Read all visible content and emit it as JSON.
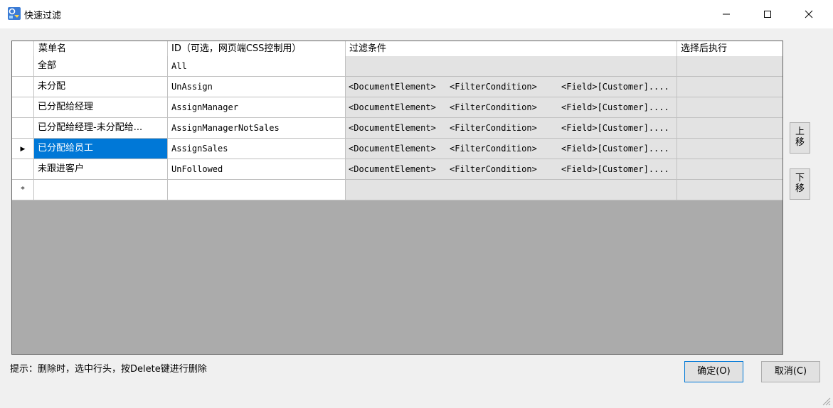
{
  "window": {
    "title": "快速过滤",
    "icons": {
      "app": "app-filter-icon",
      "minimize": "minimize-icon",
      "maximize": "maximize-icon",
      "close": "close-icon"
    }
  },
  "grid": {
    "columns": [
      "菜单名",
      "ID（可选，网页端CSS控制用）",
      "过滤条件",
      "选择后执行"
    ],
    "rows": [
      {
        "name": "全部",
        "id": "All",
        "filter": [
          "",
          "",
          ""
        ],
        "after": ""
      },
      {
        "name": "未分配",
        "id": "UnAssign",
        "filter": [
          "<DocumentElement>",
          "<FilterCondition>",
          "<Field>[Customer]...."
        ],
        "after": ""
      },
      {
        "name": "已分配给经理",
        "id": "AssignManager",
        "filter": [
          "<DocumentElement>",
          "<FilterCondition>",
          "<Field>[Customer]...."
        ],
        "after": ""
      },
      {
        "name": "已分配给经理-未分配给...",
        "id": "AssignManagerNotSales",
        "filter": [
          "<DocumentElement>",
          "<FilterCondition>",
          "<Field>[Customer]...."
        ],
        "after": ""
      },
      {
        "name": "已分配给员工",
        "id": "AssignSales",
        "filter": [
          "<DocumentElement>",
          "<FilterCondition>",
          "<Field>[Customer]...."
        ],
        "after": ""
      },
      {
        "name": "未跟进客户",
        "id": "UnFollowed",
        "filter": [
          "<DocumentElement>",
          "<FilterCondition>",
          "<Field>[Customer]...."
        ],
        "after": ""
      }
    ],
    "current_row_marker": "▶",
    "new_row_marker": "*",
    "selected_row": 4
  },
  "side": {
    "move_up": "上移",
    "move_down": "下移"
  },
  "footer": {
    "hint": "提示：删除时，选中行头，按Delete键进行删除",
    "ok_label": "确定(O)",
    "cancel_label": "取消(C)"
  },
  "colors": {
    "selection": "#0078d7",
    "grid_bg": "#ababab",
    "readonly_cell": "#e3e3e3"
  }
}
